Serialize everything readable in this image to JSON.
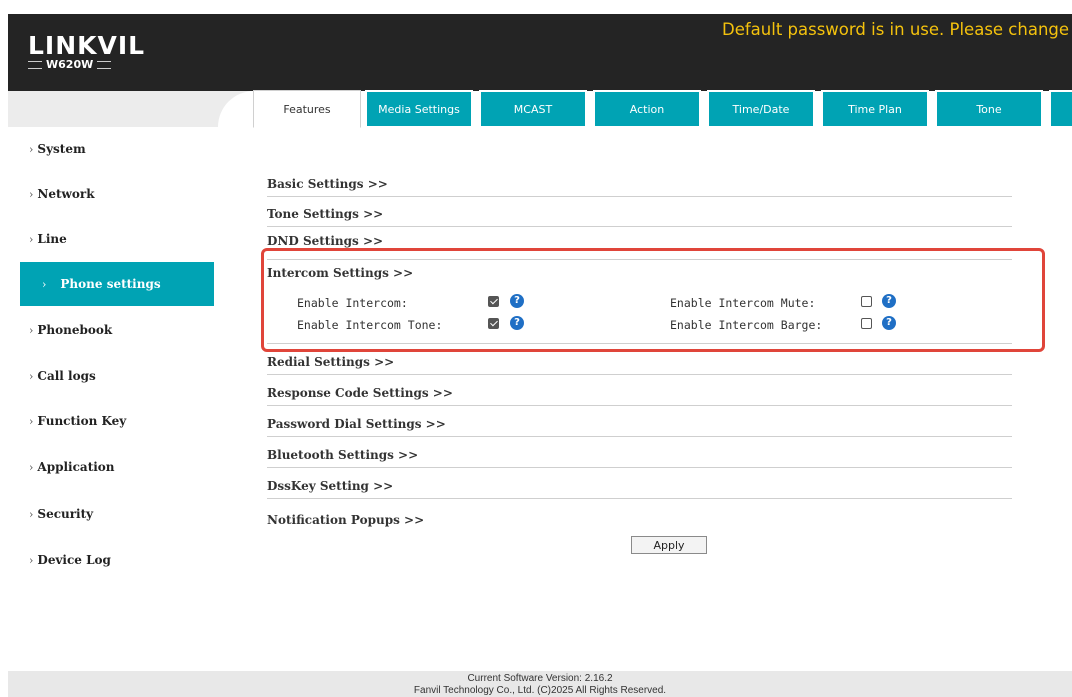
{
  "brand": {
    "logo": "LINKVIL",
    "model": "W620W"
  },
  "warning": "Default password is in use. Please change",
  "tabs": [
    "Features",
    "Media Settings",
    "MCAST",
    "Action",
    "Time/Date",
    "Time Plan",
    "Tone"
  ],
  "sidebar": {
    "items": [
      {
        "label": "System"
      },
      {
        "label": "Network"
      },
      {
        "label": "Line"
      },
      {
        "label": "Phone settings"
      },
      {
        "label": "Phonebook"
      },
      {
        "label": "Call logs"
      },
      {
        "label": "Function Key"
      },
      {
        "label": "Application"
      },
      {
        "label": "Security"
      },
      {
        "label": "Device Log"
      }
    ]
  },
  "sections_top": [
    {
      "label": "Basic Settings >>"
    },
    {
      "label": "Tone Settings >>"
    },
    {
      "label": "DND Settings >>"
    }
  ],
  "intercom": {
    "title": "Intercom Settings >>",
    "enable_intercom": {
      "label": "Enable Intercom:",
      "checked": true
    },
    "enable_intercom_tone": {
      "label": "Enable Intercom Tone:",
      "checked": true
    },
    "enable_intercom_mute": {
      "label": "Enable Intercom Mute:",
      "checked": false
    },
    "enable_intercom_barge": {
      "label": "Enable Intercom Barge:",
      "checked": false
    },
    "help_glyph": "?"
  },
  "sections_bottom": [
    {
      "label": "Redial Settings >>"
    },
    {
      "label": "Response Code Settings >>"
    },
    {
      "label": "Password Dial Settings >>"
    },
    {
      "label": "Bluetooth Settings >>"
    },
    {
      "label": "DssKey Setting >>"
    },
    {
      "label": "Notification Popups >>"
    }
  ],
  "apply_label": "Apply",
  "footer": {
    "version": "Current Software Version: 2.16.2",
    "copyright": "Fanvil Technology Co., Ltd. (C)2025 All Rights Reserved."
  },
  "colors": {
    "accent": "#00a3b4",
    "warning": "#f4c20d",
    "header": "#242424",
    "highlight": "#e0453a",
    "help": "#1f6fc5"
  }
}
